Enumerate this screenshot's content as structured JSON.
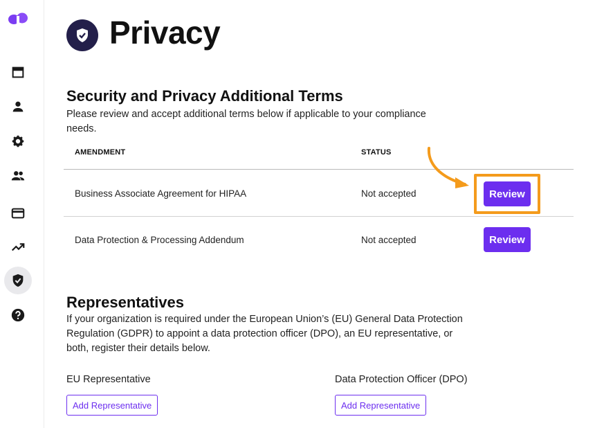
{
  "page": {
    "title": "Privacy",
    "icon": "shield-check-icon"
  },
  "sidebar": {
    "logo": "brand-logo",
    "items": [
      {
        "icon": "calendar-icon"
      },
      {
        "icon": "user-icon"
      },
      {
        "icon": "gear-icon"
      },
      {
        "icon": "people-icon"
      },
      {
        "icon": "credit-card-icon"
      },
      {
        "icon": "trending-up-icon"
      },
      {
        "icon": "shield-check-icon",
        "active": true
      },
      {
        "icon": "help-icon"
      }
    ]
  },
  "terms": {
    "title": "Security and Privacy Additional Terms",
    "description": "Please review and accept additional terms below if applicable to your compliance needs.",
    "columns": {
      "amendment": "AMENDMENT",
      "status": "STATUS"
    },
    "rows": [
      {
        "amendment": "Business Associate Agreement for HIPAA",
        "status": "Not accepted",
        "action": "Review"
      },
      {
        "amendment": "Data Protection & Processing Addendum",
        "status": "Not accepted",
        "action": "Review"
      }
    ]
  },
  "representatives": {
    "title": "Representatives",
    "description": "If your organization is required under the European Union’s (EU) General Data Protection Regulation (GDPR) to appoint a data protection officer (DPO), an EU representative, or both, register their details below.",
    "eu": {
      "label": "EU Representative",
      "button": "Add Representative"
    },
    "dpo": {
      "label": "Data Protection Officer (DPO)",
      "button": "Add Representative"
    }
  },
  "colors": {
    "accent": "#6c2eef",
    "highlight": "#f49b1c",
    "page_icon_bg": "#231f4a"
  }
}
